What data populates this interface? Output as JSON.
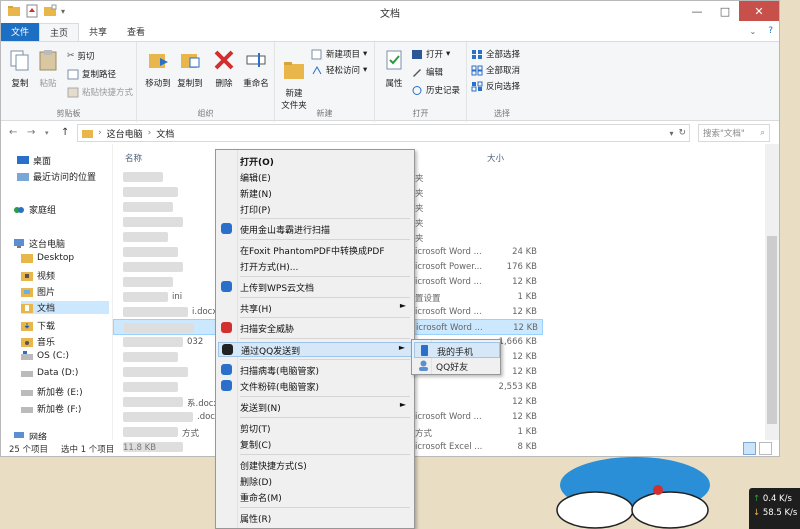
{
  "window": {
    "title": "文档",
    "controls": {
      "minimize": "—",
      "maximize": "□",
      "close": "✕"
    }
  },
  "tabs": [
    "文件",
    "主页",
    "共享",
    "查看"
  ],
  "ribbon": {
    "groups": {
      "clipboard": "剪贴板",
      "organize": "组织",
      "new": "新建",
      "open": "打开",
      "select": "选择"
    },
    "copy": "复制",
    "paste": "粘贴",
    "cut": "剪切",
    "copy_path": "复制路径",
    "paste_shortcut": "粘贴快捷方式",
    "move_to": "移动到",
    "copy_to": "复制到",
    "delete": "删除",
    "rename": "重命名",
    "new_folder": "新建\n文件夹",
    "new_item": "新建项目",
    "easy_access": "轻松访问",
    "properties": "属性",
    "open": "打开",
    "edit": "编辑",
    "history": "历史记录",
    "select_all": "全部选择",
    "select_none": "全部取消",
    "invert_selection": "反向选择"
  },
  "address": {
    "crumbs": [
      "这台电脑",
      "文档"
    ],
    "search_placeholder": "搜索\"文档\""
  },
  "nav": [
    "桌面",
    "最近访问的位置",
    "家庭组",
    "这台电脑",
    "Desktop",
    "视频",
    "图片",
    "文档",
    "下载",
    "音乐",
    "OS (C:)",
    "Data (D:)",
    "新加卷 (E:)",
    "新加卷 (F:)",
    "网络"
  ],
  "columns": {
    "name": "名称",
    "size": "大小"
  },
  "rows": [
    {
      "name": "",
      "type": "夹",
      "size": ""
    },
    {
      "name": "",
      "type": "夹",
      "size": ""
    },
    {
      "name": "",
      "type": "夹",
      "size": ""
    },
    {
      "name": "",
      "type": "夹",
      "size": ""
    },
    {
      "name": "",
      "type": "夹",
      "size": ""
    },
    {
      "name": "",
      "type": "icrosoft Word ...",
      "size": "24 KB"
    },
    {
      "name": "",
      "type": "icrosoft Power...",
      "size": "176 KB"
    },
    {
      "name": "",
      "type": "icrosoft Word ...",
      "size": "12 KB"
    },
    {
      "name": "ini",
      "type": "置设置",
      "size": "1 KB"
    },
    {
      "name": "i.docx",
      "type": "icrosoft Word ...",
      "size": "12 KB"
    },
    {
      "name": "",
      "type": "icrosoft Word ...",
      "size": "12 KB"
    },
    {
      "name": "032",
      "type": "",
      "size": "1,666 KB"
    },
    {
      "name": "",
      "type": "",
      "size": "12 KB"
    },
    {
      "name": "",
      "type": "",
      "size": "12 KB"
    },
    {
      "name": "",
      "type": "",
      "size": "2,553 KB"
    },
    {
      "name": "系.docx",
      "type": "",
      "size": "12 KB"
    },
    {
      "name": ".docx1.do",
      "type": "icrosoft Word ...",
      "size": "12 KB"
    },
    {
      "name": "方式",
      "type": "方式",
      "size": "1 KB"
    },
    {
      "name": "",
      "type": "icrosoft Excel ...",
      "size": "8 KB"
    }
  ],
  "status": {
    "count": "25 个项目",
    "selected": "选中 1 个项目",
    "size": "11.8 KB"
  },
  "context_menu": {
    "items": [
      {
        "label": "打开(O)",
        "bold": true
      },
      {
        "label": "编辑(E)"
      },
      {
        "label": "新建(N)"
      },
      {
        "label": "打印(P)"
      },
      {
        "label": "使用金山毒霸进行扫描"
      },
      {
        "label": "在Foxit PhantomPDF中转换成PDF"
      },
      {
        "label": "打开方式(H)..."
      },
      {
        "label": "上传到WPS云文档"
      },
      {
        "label": "共享(H)"
      },
      {
        "label": "扫描安全威胁"
      },
      {
        "label": "通过QQ发送到"
      },
      {
        "label": "扫描病毒(电脑管家)"
      },
      {
        "label": "文件粉碎(电脑管家)"
      },
      {
        "label": "发送到(N)"
      },
      {
        "label": "剪切(T)"
      },
      {
        "label": "复制(C)"
      },
      {
        "label": "创建快捷方式(S)"
      },
      {
        "label": "删除(D)"
      },
      {
        "label": "重命名(M)"
      },
      {
        "label": "属性(R)"
      }
    ],
    "submenu_arrow": "►"
  },
  "submenu": {
    "items": [
      "我的手机",
      "QQ好友"
    ]
  },
  "tray": {
    "up": "0.4 K/s",
    "down": "58.5 K/s",
    "up_arrow": "↑",
    "down_arrow": "↓"
  },
  "colors": {
    "accent": "#1d6fc3",
    "selection": "#cce8ff",
    "menu_highlight": "#d6e8f7"
  }
}
